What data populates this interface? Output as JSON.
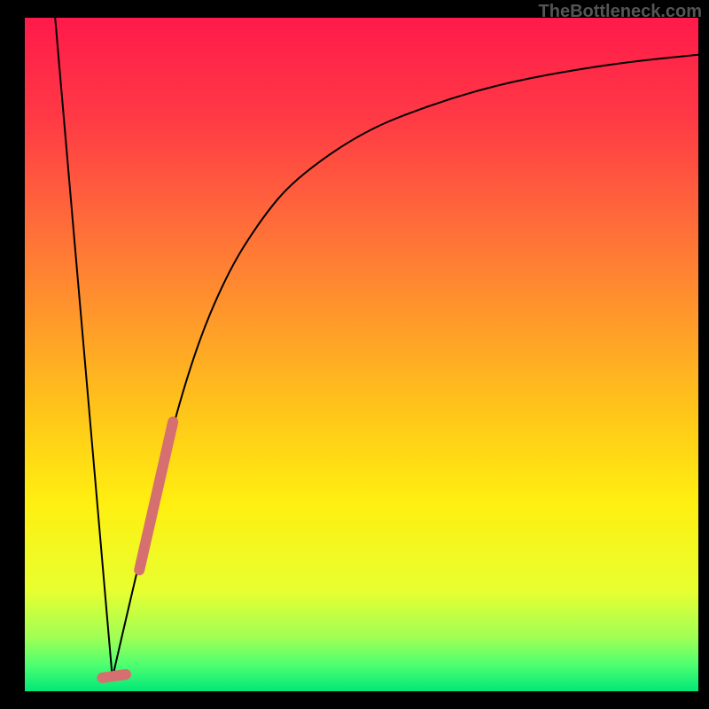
{
  "watermark": "TheBottleneck.com",
  "chart_data": {
    "type": "line",
    "title": "",
    "xlabel": "",
    "ylabel": "",
    "xlim": [
      0,
      100
    ],
    "ylim": [
      0,
      100
    ],
    "gradient_stops": [
      {
        "offset": 0,
        "color": "#ff1a4a"
      },
      {
        "offset": 15,
        "color": "#ff3a45"
      },
      {
        "offset": 30,
        "color": "#ff6a3a"
      },
      {
        "offset": 45,
        "color": "#ff9a2a"
      },
      {
        "offset": 60,
        "color": "#ffca18"
      },
      {
        "offset": 72,
        "color": "#ffef10"
      },
      {
        "offset": 85,
        "color": "#e8ff30"
      },
      {
        "offset": 92,
        "color": "#a0ff55"
      },
      {
        "offset": 96,
        "color": "#50ff70"
      },
      {
        "offset": 100,
        "color": "#00e878"
      }
    ],
    "series": [
      {
        "name": "left-descent",
        "type": "line",
        "color": "#000000",
        "width": 2,
        "points": [
          {
            "x": 4.5,
            "y": 100
          },
          {
            "x": 13,
            "y": 2
          }
        ]
      },
      {
        "name": "right-curve",
        "type": "curve",
        "color": "#000000",
        "width": 2,
        "points": [
          {
            "x": 13,
            "y": 2
          },
          {
            "x": 16,
            "y": 15
          },
          {
            "x": 20,
            "y": 32
          },
          {
            "x": 25,
            "y": 50
          },
          {
            "x": 30,
            "y": 62
          },
          {
            "x": 35,
            "y": 70
          },
          {
            "x": 40,
            "y": 76
          },
          {
            "x": 50,
            "y": 83
          },
          {
            "x": 60,
            "y": 87
          },
          {
            "x": 70,
            "y": 90
          },
          {
            "x": 80,
            "y": 92
          },
          {
            "x": 90,
            "y": 93.5
          },
          {
            "x": 100,
            "y": 94.5
          }
        ]
      },
      {
        "name": "highlight-segment",
        "type": "line",
        "color": "#d67070",
        "width": 10,
        "points": [
          {
            "x": 17,
            "y": 18
          },
          {
            "x": 22,
            "y": 40
          }
        ]
      },
      {
        "name": "highlight-bottom",
        "type": "line",
        "color": "#d67070",
        "width": 10,
        "points": [
          {
            "x": 11.5,
            "y": 2
          },
          {
            "x": 15,
            "y": 2.5
          }
        ]
      }
    ]
  }
}
